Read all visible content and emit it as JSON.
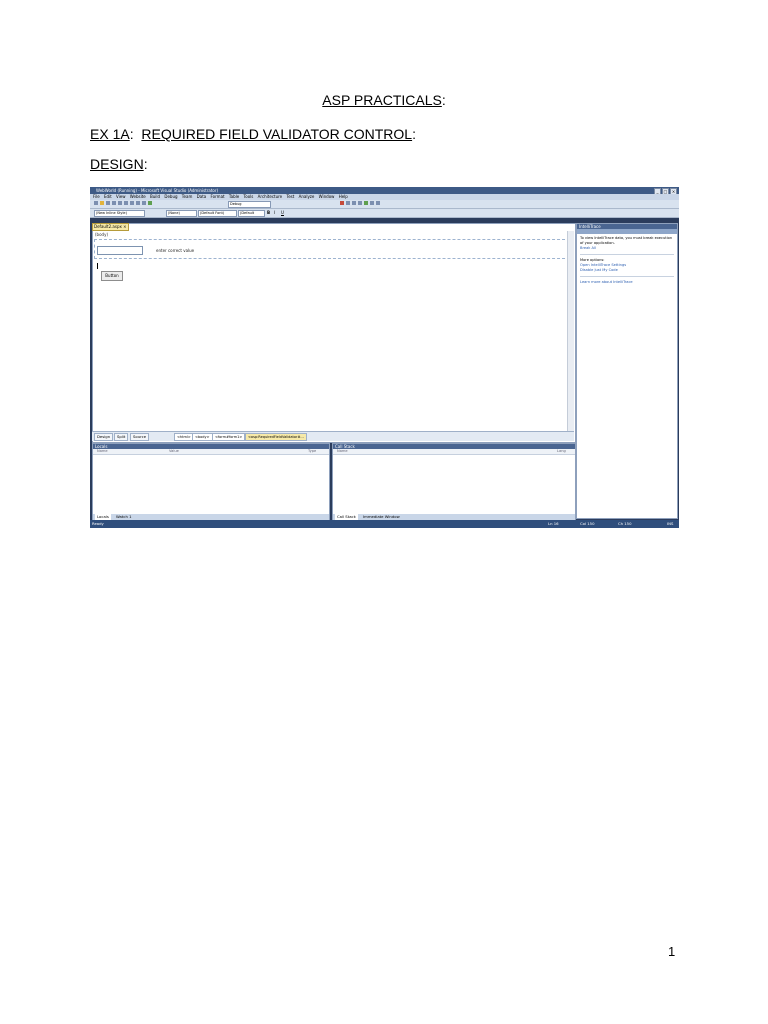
{
  "document": {
    "title": "ASP PRACTICALS",
    "title_suffix": ":",
    "ex_label": "EX 1A",
    "ex_sep": ":",
    "ex_title": "REQUIRED FIELD VALIDATOR CONTROL",
    "ex_suffix": ":",
    "design_label": "DESIGN",
    "design_suffix": ":",
    "page_number": "1"
  },
  "screenshot": {
    "window_title": "WebWorld (Running) - Microsoft Visual Studio (Administrator)",
    "menu": [
      "File",
      "Edit",
      "View",
      "Website",
      "Build",
      "Debug",
      "Team",
      "Data",
      "Format",
      "Table",
      "Tools",
      "Architecture",
      "Test",
      "Analyze",
      "Window",
      "Help"
    ],
    "toolbar": {
      "config_combo": "Debug",
      "view_combo": "(New Inline Style)",
      "block_combo": "(None)",
      "font_combo": "(Default Font)",
      "size_combo": "(Default",
      "bold": "B",
      "italic": "I",
      "underline": "U"
    },
    "editor": {
      "tab": "Default2.aspx",
      "tab_close": "×",
      "body_tag": "(body)",
      "validator_text": "enter correct value",
      "button_label": "Button"
    },
    "view_tabs": [
      "Design",
      "Split",
      "Source"
    ],
    "breadcrumbs": [
      "<html>",
      "<body>",
      "<form#form1>",
      "<asp:RequiredFieldValidator#..."
    ],
    "locals": {
      "title": "Locals",
      "col_name": "Name",
      "col_value": "Value",
      "col_type": "Type",
      "tabs": [
        "Locals",
        "Watch 1"
      ]
    },
    "callstack": {
      "title": "Call Stack",
      "col_name": "Name",
      "col_lang": "Lang",
      "tabs": [
        "Call Stack",
        "Immediate Window"
      ]
    },
    "intellitrace": {
      "title": "IntelliTrace",
      "info": "To view IntelliTrace data, you must break execution of your application.",
      "break_all": "Break All",
      "more_options": "More options:",
      "open_settings": "Open IntelliTrace Settings",
      "disable": "Disable Just My Code",
      "learn_more": "Learn more about IntelliTrace"
    },
    "status": {
      "left": "Ready",
      "ln": "Ln 16",
      "col": "Col 150",
      "ch": "Ch 150",
      "ins": "INS"
    }
  }
}
